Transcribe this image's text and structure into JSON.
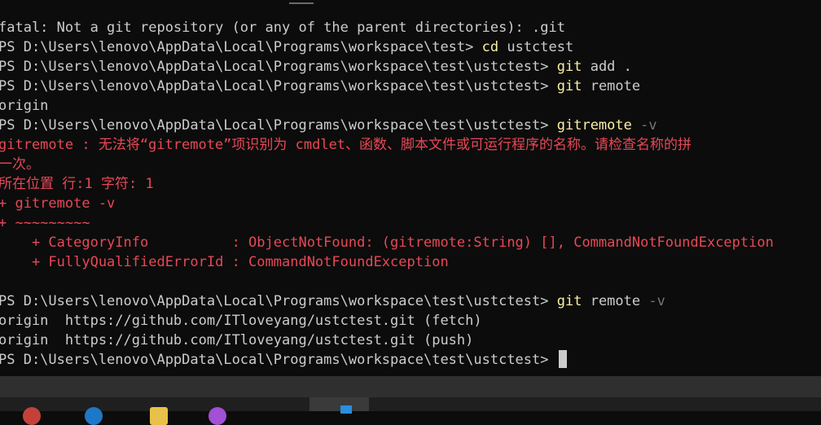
{
  "terminal": {
    "lines": [
      {
        "segments": [
          {
            "text": "fatal: Not a git repository (or any of the parent directories): .git",
            "kind": "out"
          }
        ]
      },
      {
        "segments": [
          {
            "text": "PS D:\\Users\\lenovo\\AppData\\Local\\Programs\\workspace\\test> ",
            "kind": "out"
          },
          {
            "text": "cd",
            "kind": "cmd"
          },
          {
            "text": " ustctest",
            "kind": "out"
          }
        ]
      },
      {
        "segments": [
          {
            "text": "PS D:\\Users\\lenovo\\AppData\\Local\\Programs\\workspace\\test\\ustctest> ",
            "kind": "out"
          },
          {
            "text": "git",
            "kind": "cmd"
          },
          {
            "text": " add .",
            "kind": "out"
          }
        ]
      },
      {
        "segments": [
          {
            "text": "PS D:\\Users\\lenovo\\AppData\\Local\\Programs\\workspace\\test\\ustctest> ",
            "kind": "out"
          },
          {
            "text": "git",
            "kind": "cmd"
          },
          {
            "text": " remote",
            "kind": "out"
          }
        ]
      },
      {
        "segments": [
          {
            "text": "origin",
            "kind": "out"
          }
        ]
      },
      {
        "segments": [
          {
            "text": "PS D:\\Users\\lenovo\\AppData\\Local\\Programs\\workspace\\test\\ustctest> ",
            "kind": "out"
          },
          {
            "text": "gitremote",
            "kind": "cmd"
          },
          {
            "text": " -v",
            "kind": "param"
          }
        ]
      },
      {
        "segments": [
          {
            "text": "gitremote : 无法将“gitremote”项识别为 cmdlet、函数、脚本文件或可运行程序的名称。请检查名称的拼",
            "kind": "err"
          }
        ]
      },
      {
        "segments": [
          {
            "text": "一次。",
            "kind": "err"
          }
        ]
      },
      {
        "segments": [
          {
            "text": "所在位置 行:1 字符: 1",
            "kind": "err"
          }
        ]
      },
      {
        "segments": [
          {
            "text": "+ gitremote -v",
            "kind": "err"
          }
        ]
      },
      {
        "segments": [
          {
            "text": "+ ~~~~~~~~~",
            "kind": "err"
          }
        ]
      },
      {
        "segments": [
          {
            "text": "    + CategoryInfo          : ObjectNotFound: (gitremote:String) [], CommandNotFoundException",
            "kind": "err"
          }
        ]
      },
      {
        "segments": [
          {
            "text": "    + FullyQualifiedErrorId : CommandNotFoundException",
            "kind": "err"
          }
        ]
      },
      {
        "segments": [
          {
            "text": "",
            "kind": "out"
          }
        ]
      },
      {
        "segments": [
          {
            "text": "PS D:\\Users\\lenovo\\AppData\\Local\\Programs\\workspace\\test\\ustctest> ",
            "kind": "out"
          },
          {
            "text": "git",
            "kind": "cmd"
          },
          {
            "text": " remote",
            "kind": "out"
          },
          {
            "text": " -v",
            "kind": "param"
          }
        ]
      },
      {
        "segments": [
          {
            "text": "origin  https://github.com/ITloveyang/ustctest.git (fetch)",
            "kind": "out"
          }
        ]
      },
      {
        "segments": [
          {
            "text": "origin  https://github.com/ITloveyang/ustctest.git (push)",
            "kind": "out"
          }
        ]
      },
      {
        "segments": [
          {
            "text": "PS D:\\Users\\lenovo\\AppData\\Local\\Programs\\workspace\\test\\ustctest> ",
            "kind": "out"
          }
        ],
        "cursor": true
      }
    ]
  },
  "colors": {
    "background": "#0c0c0c",
    "text": "#cccccc",
    "command": "#f9f1a5",
    "parameter": "#767676",
    "error": "#e74856"
  },
  "taskbar": {
    "icons": [
      "browser-icon",
      "edge-icon",
      "folder-icon",
      "media-icon",
      "vscode-icon"
    ]
  }
}
